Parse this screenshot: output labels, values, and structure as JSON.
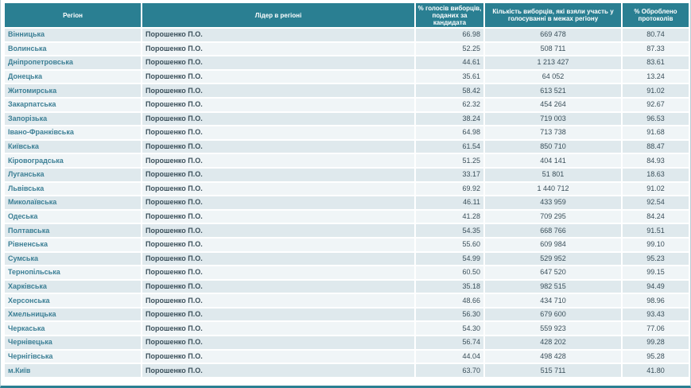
{
  "table": {
    "headers": {
      "region": "Регіон",
      "leader": "Лідер в регіоні",
      "percent_votes": "% голосів виборців, поданих за кандидата",
      "voters_count": "Кількість виборців, які взяли участь у голосуванні в межах регіону",
      "processed": "% Оброблено протоколів"
    },
    "rows": [
      {
        "region": "Вінницька",
        "leader": "Порошенко П.О.",
        "percent": "66.98",
        "voters": "669 478",
        "processed": "80.74"
      },
      {
        "region": "Волинська",
        "leader": "Порошенко П.О.",
        "percent": "52.25",
        "voters": "508 711",
        "processed": "87.33"
      },
      {
        "region": "Дніпропетровська",
        "leader": "Порошенко П.О.",
        "percent": "44.61",
        "voters": "1 213 427",
        "processed": "83.61"
      },
      {
        "region": "Донецька",
        "leader": "Порошенко П.О.",
        "percent": "35.61",
        "voters": "64 052",
        "processed": "13.24"
      },
      {
        "region": "Житомирська",
        "leader": "Порошенко П.О.",
        "percent": "58.42",
        "voters": "613 521",
        "processed": "91.02"
      },
      {
        "region": "Закарпатська",
        "leader": "Порошенко П.О.",
        "percent": "62.32",
        "voters": "454 264",
        "processed": "92.67"
      },
      {
        "region": "Запорізька",
        "leader": "Порошенко П.О.",
        "percent": "38.24",
        "voters": "719 003",
        "processed": "96.53"
      },
      {
        "region": "Івано-Франківська",
        "leader": "Порошенко П.О.",
        "percent": "64.98",
        "voters": "713 738",
        "processed": "91.68"
      },
      {
        "region": "Київська",
        "leader": "Порошенко П.О.",
        "percent": "61.54",
        "voters": "850 710",
        "processed": "88.47"
      },
      {
        "region": "Кіровоградська",
        "leader": "Порошенко П.О.",
        "percent": "51.25",
        "voters": "404 141",
        "processed": "84.93"
      },
      {
        "region": "Луганська",
        "leader": "Порошенко П.О.",
        "percent": "33.17",
        "voters": "51 801",
        "processed": "18.63"
      },
      {
        "region": "Львівська",
        "leader": "Порошенко П.О.",
        "percent": "69.92",
        "voters": "1 440 712",
        "processed": "91.02"
      },
      {
        "region": "Миколаївська",
        "leader": "Порошенко П.О.",
        "percent": "46.11",
        "voters": "433 959",
        "processed": "92.54"
      },
      {
        "region": "Одеська",
        "leader": "Порошенко П.О.",
        "percent": "41.28",
        "voters": "709 295",
        "processed": "84.24"
      },
      {
        "region": "Полтавська",
        "leader": "Порошенко П.О.",
        "percent": "54.35",
        "voters": "668 766",
        "processed": "91.51"
      },
      {
        "region": "Рівненська",
        "leader": "Порошенко П.О.",
        "percent": "55.60",
        "voters": "609 984",
        "processed": "99.10"
      },
      {
        "region": "Сумська",
        "leader": "Порошенко П.О.",
        "percent": "54.99",
        "voters": "529 952",
        "processed": "95.23"
      },
      {
        "region": "Тернопільська",
        "leader": "Порошенко П.О.",
        "percent": "60.50",
        "voters": "647 520",
        "processed": "99.15"
      },
      {
        "region": "Харківська",
        "leader": "Порошенко П.О.",
        "percent": "35.18",
        "voters": "982 515",
        "processed": "94.49"
      },
      {
        "region": "Херсонська",
        "leader": "Порошенко П.О.",
        "percent": "48.66",
        "voters": "434 710",
        "processed": "98.96"
      },
      {
        "region": "Хмельницька",
        "leader": "Порошенко П.О.",
        "percent": "56.30",
        "voters": "679 600",
        "processed": "93.43"
      },
      {
        "region": "Черкаська",
        "leader": "Порошенко П.О.",
        "percent": "54.30",
        "voters": "559 923",
        "processed": "77.06"
      },
      {
        "region": "Чернівецька",
        "leader": "Порошенко П.О.",
        "percent": "56.74",
        "voters": "428 202",
        "processed": "99.28"
      },
      {
        "region": "Чернігівська",
        "leader": "Порошенко П.О.",
        "percent": "44.04",
        "voters": "498 428",
        "processed": "95.28"
      },
      {
        "region": "м.Київ",
        "leader": "Порошенко П.О.",
        "percent": "63.70",
        "voters": "515 711",
        "processed": "41.80"
      }
    ]
  },
  "colors": {
    "header_bg": "#2a7f92",
    "row_odd": "#dfe9ed",
    "row_even": "#f0f5f7",
    "region_text": "#3c7f95"
  }
}
